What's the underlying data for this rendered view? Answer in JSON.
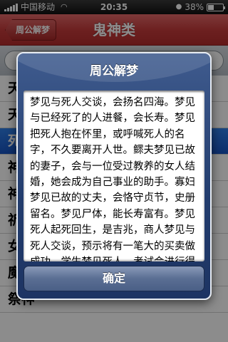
{
  "status_bar": {
    "carrier": "中国移动",
    "time": "20:35",
    "battery_text": "38%",
    "battery_level": 0.38
  },
  "nav": {
    "back_label": "周公解梦",
    "title": "鬼神类"
  },
  "list": {
    "items": [
      {
        "label": "天使"
      },
      {
        "label": "天"
      },
      {
        "label": "死"
      },
      {
        "label": "神"
      },
      {
        "label": "神"
      },
      {
        "label": "祈"
      },
      {
        "label": "女神"
      },
      {
        "label": "魔鬼"
      },
      {
        "label": "祭神"
      }
    ],
    "selected_index": 2
  },
  "alert": {
    "title": "周公解梦",
    "message": "梦见与死人交谈，会扬名四海。梦见与已经死了的人进餐，会长寿。梦见把死人抱在怀里，或呼喊死人的名字，不久要离开人世。鳏夫梦见已故的妻子，会与一位受过教养的女人结婚，她会成为自己事业的助手。寡妇梦见已故的丈夫，会恪守贞节，史册留名。梦见尸体，能长寿富有。梦见死人起死回生，是吉兆，商人梦见与死人交谈，预示将有一笔大的买卖做成功。学生梦见死人，考试会进行得很顺利。",
    "confirm_label": "确定"
  },
  "icons": {
    "signal": "signal-icon",
    "wifi": "wifi-icon",
    "lock": "rotation-lock-icon",
    "battery": "battery-icon"
  }
}
